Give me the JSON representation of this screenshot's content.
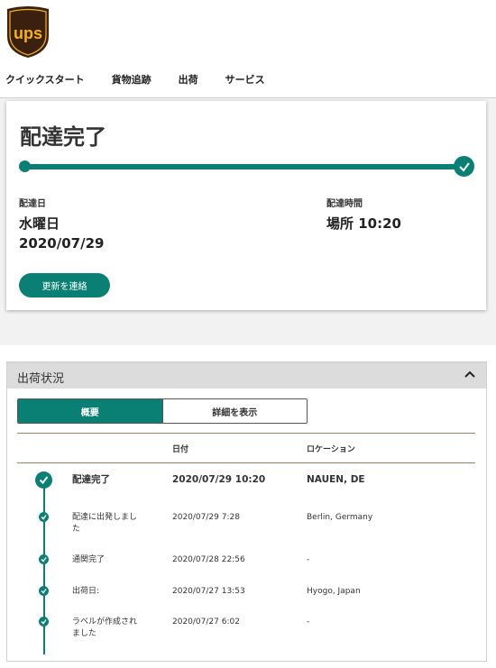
{
  "brand": {
    "logo_text": "ups",
    "color": "#3b1f0f",
    "gold": "#f6b40e"
  },
  "nav": [
    "クイックスタート",
    "貨物追跡",
    "出荷",
    "サービス"
  ],
  "status": {
    "title": "配達完了",
    "date_label": "配達日",
    "weekday": "水曜日",
    "date": "2020/07/29",
    "time_label": "配達時間",
    "time_value": "場所 10:20",
    "update_button": "更新を連絡",
    "progress_percent": 100
  },
  "shipment": {
    "section_title": "出荷状況",
    "tabs": {
      "summary": "概要",
      "details": "詳細を表示"
    },
    "columns": {
      "date": "日付",
      "location": "ロケーション"
    },
    "events": [
      {
        "status": "配達完了",
        "date": "2020/07/29  10:20",
        "location": "NAUEN, DE"
      },
      {
        "status": "配達に出発しました",
        "date": "2020/07/29  7:28",
        "location": "Berlin, Germany"
      },
      {
        "status": "通関完了",
        "date": "2020/07/28  22:56",
        "location": "-"
      },
      {
        "status": "出荷日:",
        "date": "2020/07/27  13:53",
        "location": "Hyogo, Japan"
      },
      {
        "status": "ラベルが作成されました",
        "date": "2020/07/27  6:02",
        "location": "-"
      }
    ]
  },
  "colors": {
    "accent": "#0a8074"
  }
}
